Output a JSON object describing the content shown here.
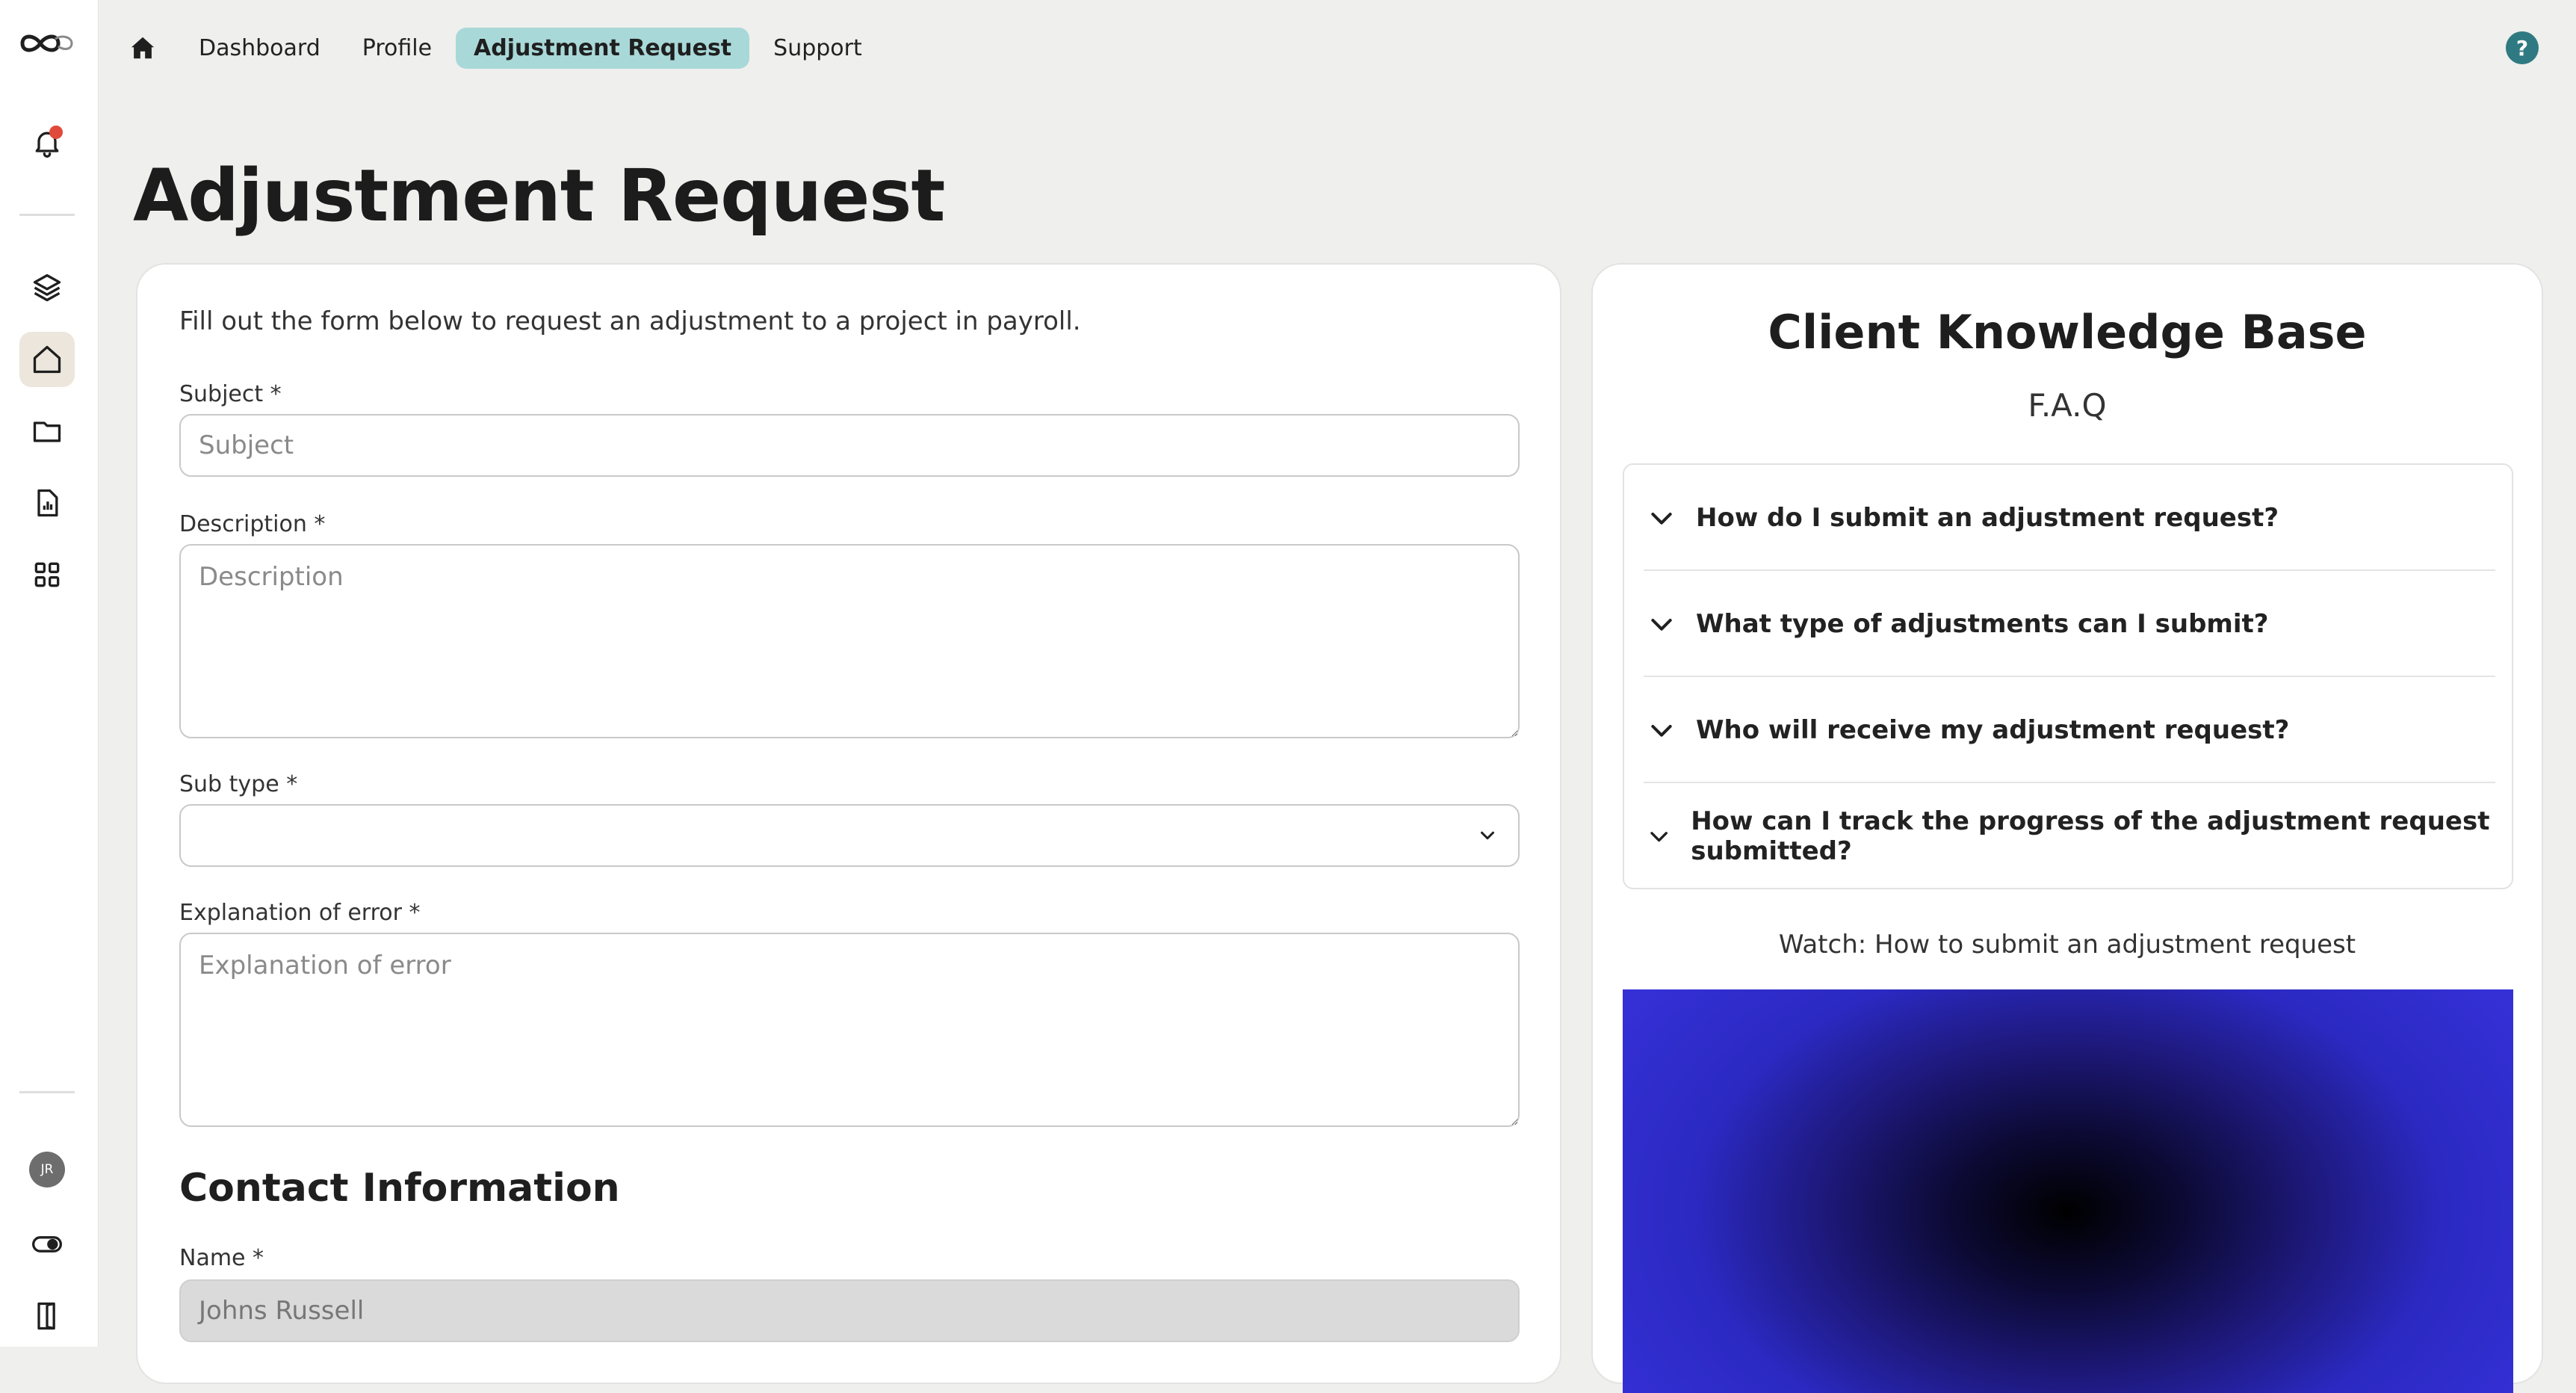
{
  "nav": {
    "links": [
      {
        "label": "Dashboard"
      },
      {
        "label": "Profile"
      },
      {
        "label": "Adjustment Request"
      },
      {
        "label": "Support"
      }
    ],
    "help": "?"
  },
  "sidebar": {
    "user_initials": "JR",
    "icons": [
      "logo-icon",
      "bell-icon",
      "layers-icon",
      "home-icon",
      "folder-icon",
      "report-icon",
      "grid-icon",
      "avatar",
      "toggle-icon",
      "logout-icon"
    ]
  },
  "page": {
    "title": "Adjustment Request"
  },
  "form": {
    "intro": "Fill out the form below to request an adjustment to a project in payroll.",
    "subject": {
      "label": "Subject *",
      "placeholder": "Subject"
    },
    "description": {
      "label": "Description *",
      "placeholder": "Description"
    },
    "subtype": {
      "label": "Sub type *",
      "value": ""
    },
    "explanation": {
      "label": "Explanation of error *",
      "placeholder": "Explanation of error"
    },
    "contact_title": "Contact Information",
    "name": {
      "label": "Name *",
      "value": "Johns Russell"
    }
  },
  "knowledge": {
    "title": "Client Knowledge Base",
    "subtitle": "F.A.Q",
    "faqs": [
      {
        "question": "How do I submit an adjustment request?"
      },
      {
        "question": "What type of adjustments can I submit?"
      },
      {
        "question": "Who will receive my adjustment request?"
      },
      {
        "question": "How can I track the progress of the adjustment request submitted?"
      }
    ],
    "watch": "Watch: How to submit an adjustment request"
  },
  "colors": {
    "accent": "#a9d8d8",
    "help": "#2f7a82",
    "notification": "#e04a3c",
    "video": "#3430d6"
  }
}
